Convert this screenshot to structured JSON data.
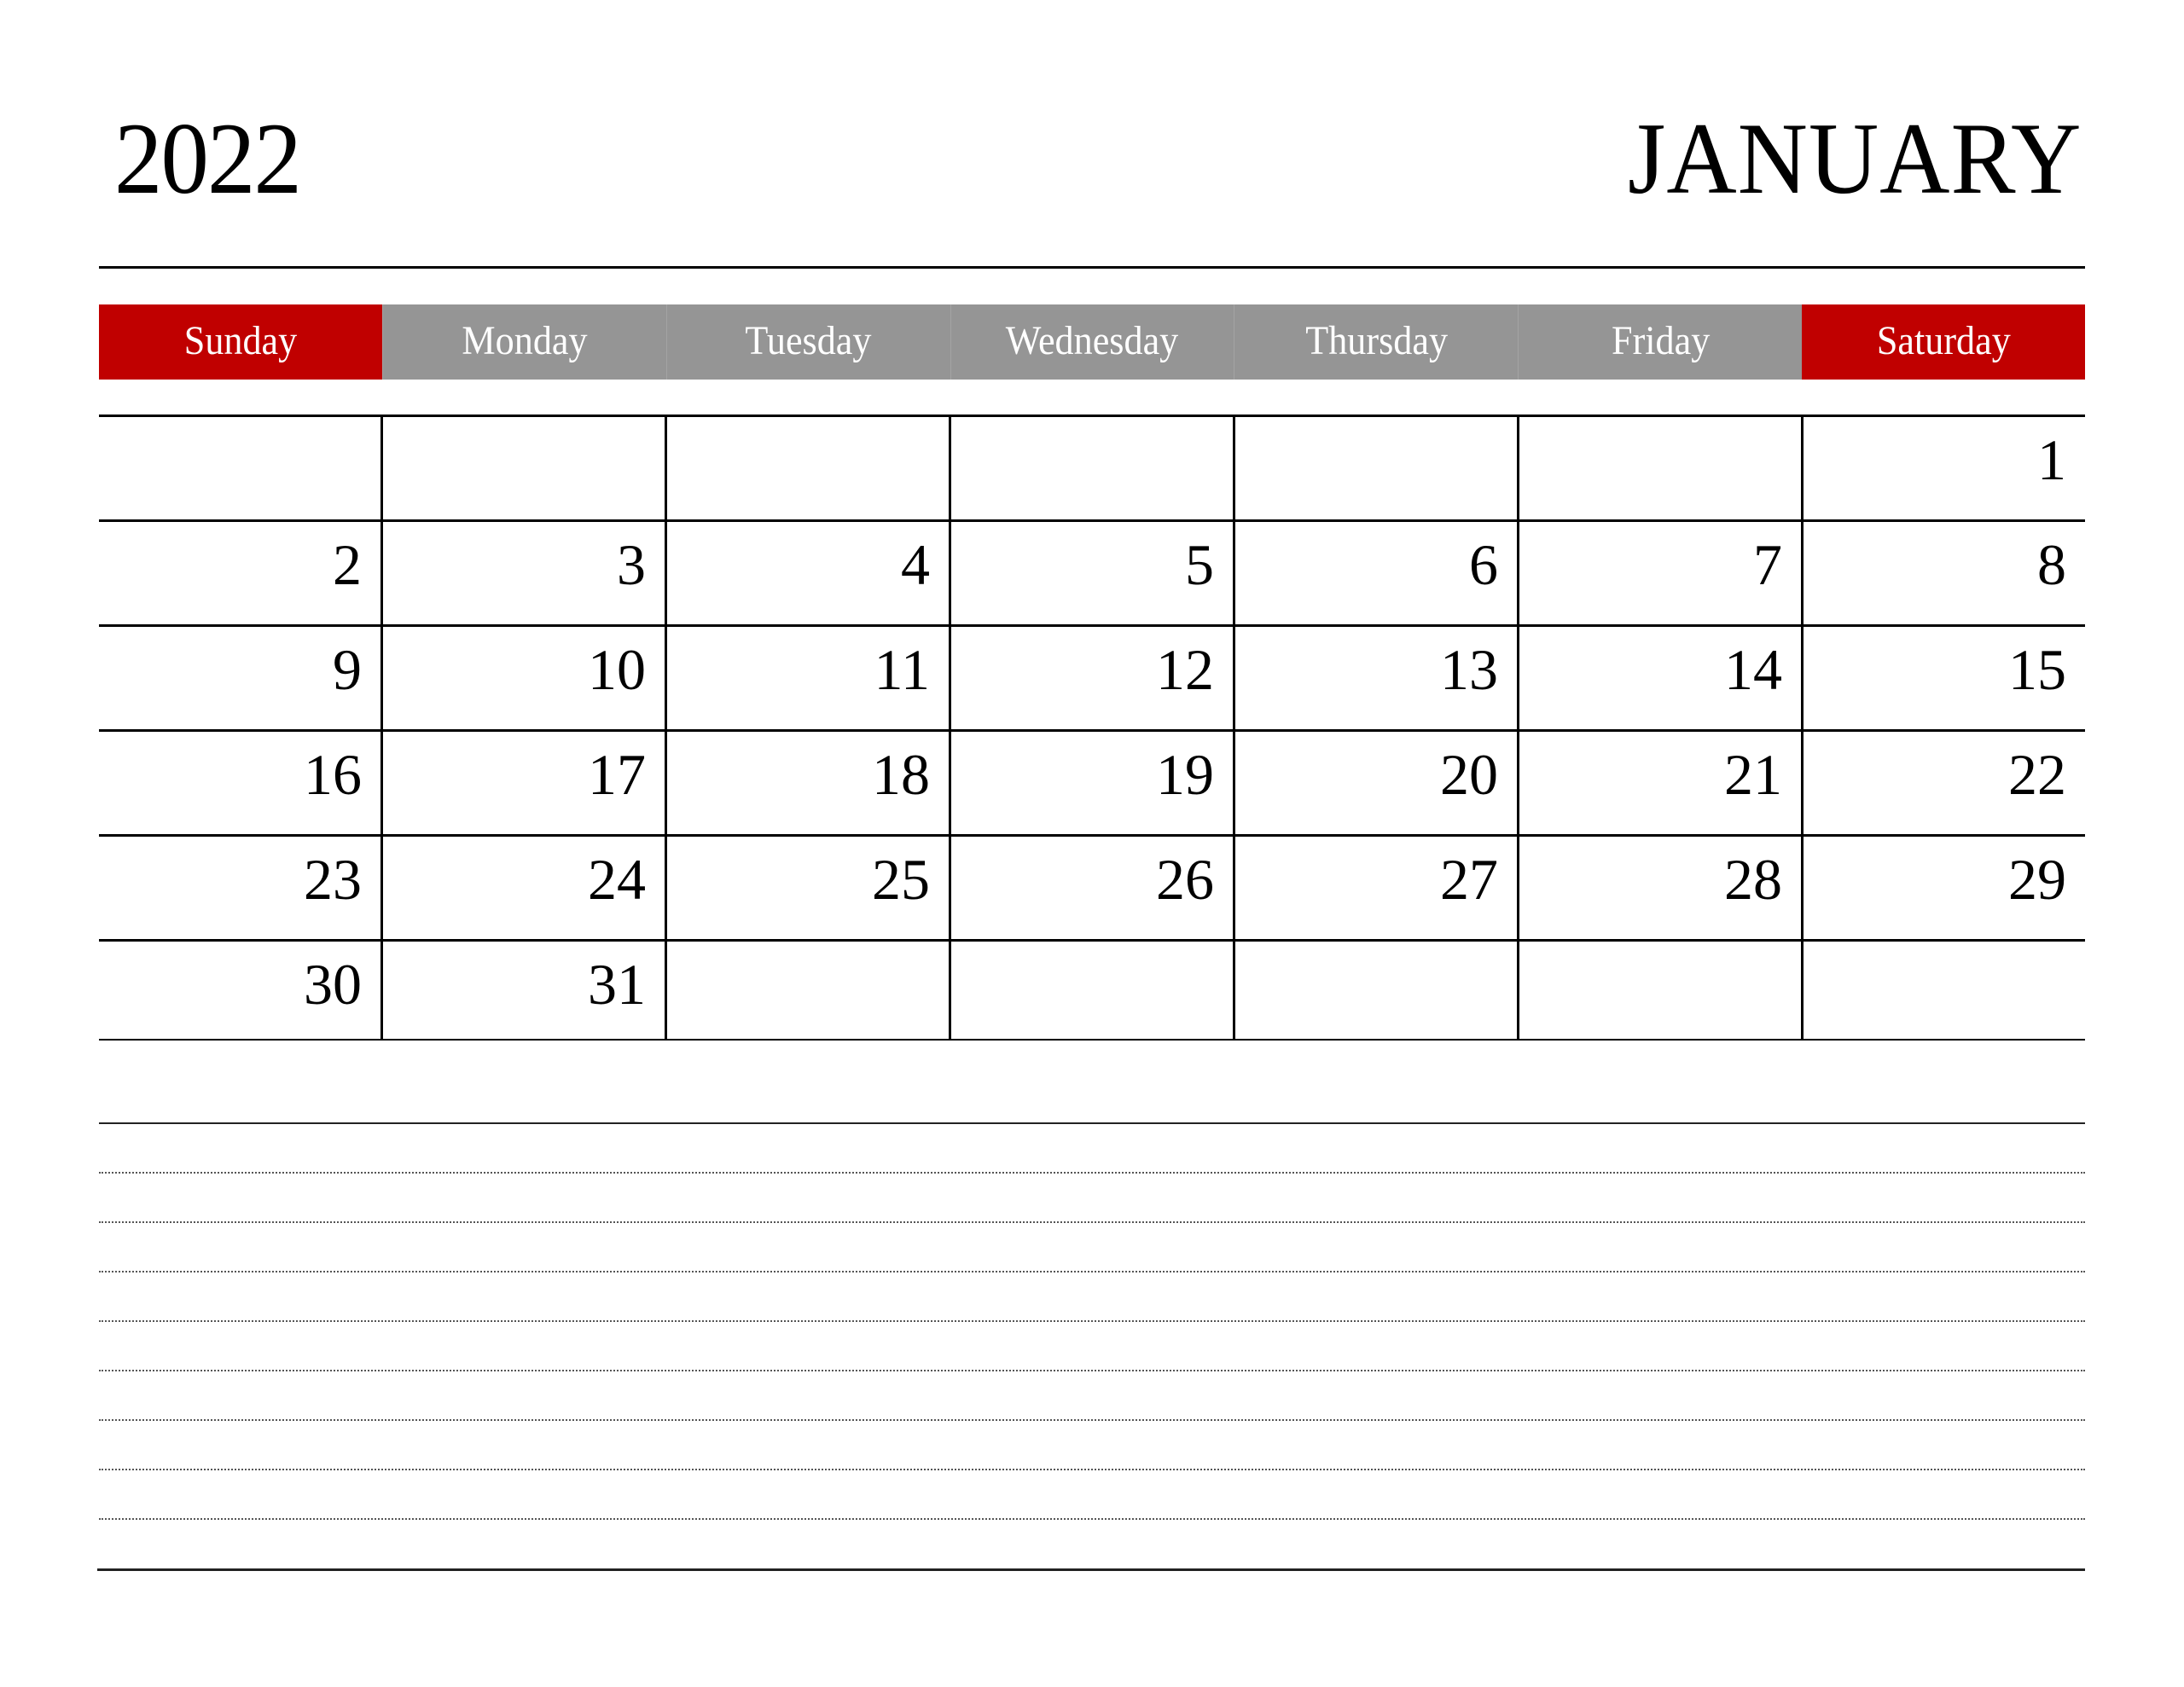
{
  "header": {
    "year": "2022",
    "month": "JANUARY"
  },
  "colors": {
    "weekend_header": "#C00000",
    "weekday_header": "#959595",
    "header_text": "#FFFFFF",
    "grid_lines": "#000000"
  },
  "weekdays": [
    {
      "label": "Sunday",
      "weekend": true
    },
    {
      "label": "Monday",
      "weekend": false
    },
    {
      "label": "Tuesday",
      "weekend": false
    },
    {
      "label": "Wednesday",
      "weekend": false
    },
    {
      "label": "Thursday",
      "weekend": false
    },
    {
      "label": "Friday",
      "weekend": false
    },
    {
      "label": "Saturday",
      "weekend": true
    }
  ],
  "weeks": [
    [
      "",
      "",
      "",
      "",
      "",
      "",
      "1"
    ],
    [
      "2",
      "3",
      "4",
      "5",
      "6",
      "7",
      "8"
    ],
    [
      "9",
      "10",
      "11",
      "12",
      "13",
      "14",
      "15"
    ],
    [
      "16",
      "17",
      "18",
      "19",
      "20",
      "21",
      "22"
    ],
    [
      "23",
      "24",
      "25",
      "26",
      "27",
      "28",
      "29"
    ],
    [
      "30",
      "31",
      "",
      "",
      "",
      "",
      ""
    ]
  ],
  "notes": {
    "line_count": 8
  }
}
